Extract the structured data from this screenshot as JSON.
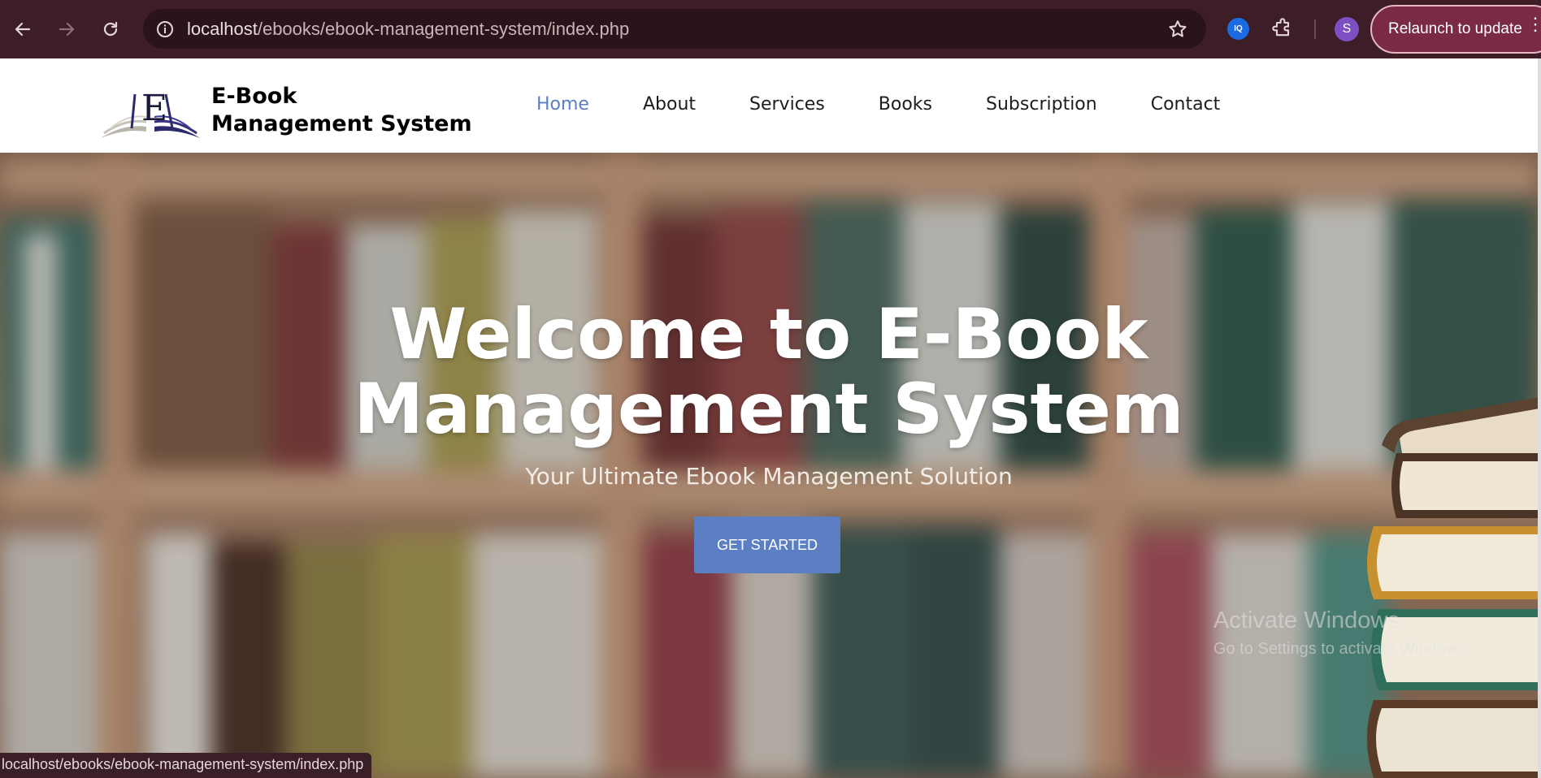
{
  "browser": {
    "url_host": "localhost",
    "url_path": "/ebooks/ebook-management-system/index.php",
    "extension_badge": "IQ",
    "profile_initial": "S",
    "relaunch_label": "Relaunch to update",
    "status_url": "localhost/ebooks/ebook-management-system/index.php"
  },
  "header": {
    "logo_letter": "E",
    "logo_line1": "E-Book",
    "logo_line2": "Management System",
    "nav": [
      {
        "label": "Home",
        "active": true
      },
      {
        "label": "About"
      },
      {
        "label": "Services"
      },
      {
        "label": "Books"
      },
      {
        "label": "Subscription"
      },
      {
        "label": "Contact"
      }
    ]
  },
  "hero": {
    "title_line1": "Welcome to E-Book",
    "title_line2": "Management System",
    "subtitle": "Your Ultimate Ebook Management Solution",
    "cta_label": "GET STARTED"
  },
  "watermark": {
    "line1": "Activate Windows",
    "line2": "Go to Settings to activate Windows."
  },
  "colors": {
    "chrome_bg": "#3d1d26",
    "accent_blue": "#5b7fc2",
    "relaunch_bg": "#7a2a44"
  },
  "icons": [
    "back-arrow-icon",
    "forward-arrow-icon",
    "reload-icon",
    "site-info-icon",
    "bookmark-star-icon",
    "extensions-puzzle-icon",
    "more-vert-icon"
  ]
}
